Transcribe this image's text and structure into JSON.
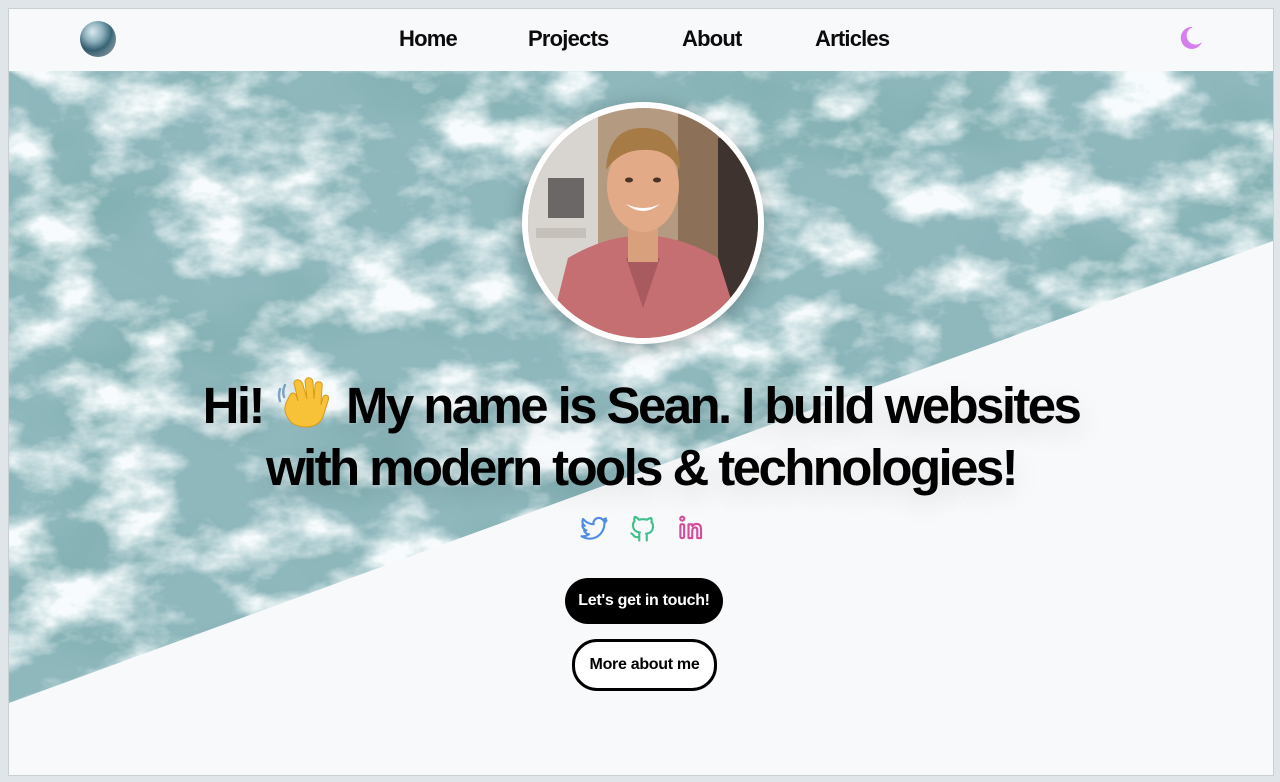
{
  "nav": {
    "items": [
      {
        "label": "Home"
      },
      {
        "label": "Projects"
      },
      {
        "label": "About"
      },
      {
        "label": "Articles"
      }
    ]
  },
  "theme_toggle": {
    "icon": "moon-icon",
    "color": "#d67ef0"
  },
  "hero": {
    "headline_part1": "Hi!",
    "headline_emoji": "waving-hand-icon",
    "headline_part2": "My name is Sean. I build websites",
    "headline_line2": "with modern tools & technologies!",
    "socials": [
      {
        "name": "twitter-icon",
        "color": "#4f8de3"
      },
      {
        "name": "github-icon",
        "color": "#3fbf8a"
      },
      {
        "name": "linkedin-icon",
        "color": "#d64b9a"
      }
    ],
    "primary_button": "Let's get in touch!",
    "secondary_button": "More about me"
  },
  "colors": {
    "background": "#f8f9fb",
    "text": "#000000",
    "ocean": "#8fb8bd"
  }
}
